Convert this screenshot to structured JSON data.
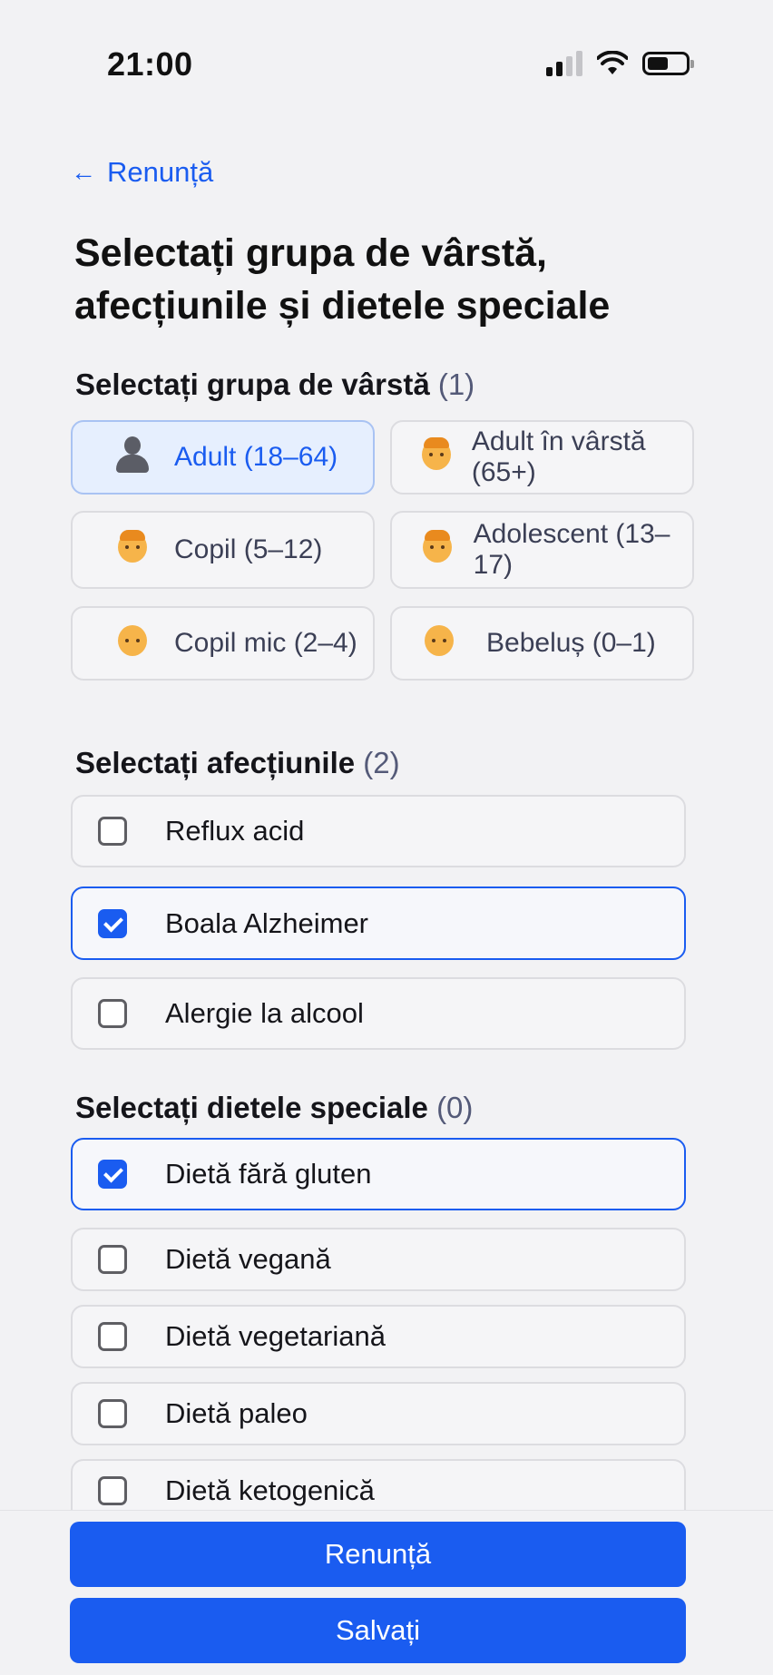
{
  "status_bar": {
    "time": "21:00",
    "signal_bars_filled": 2,
    "signal_bars_total": 4,
    "battery_level": 0.55,
    "icons": [
      "signal-icon",
      "wifi-icon",
      "battery-icon"
    ]
  },
  "header": {
    "back_arrow": "←",
    "back_label": "Renunță",
    "title": "Selectați grupa de vârstă, afecțiunile și dietele speciale"
  },
  "age_section": {
    "title": "Selectați grupa de vârstă",
    "count": "(1)",
    "options": [
      {
        "label": "Adult (18–64)",
        "icon": "person-silhouette-icon",
        "selected": true
      },
      {
        "label": "Adult în vârstă (65+)",
        "icon": "older-adult-emoji-icon",
        "selected": false
      },
      {
        "label": "Copil (5–12)",
        "icon": "child-emoji-icon",
        "selected": false
      },
      {
        "label": "Adolescent (13–17)",
        "icon": "teen-emoji-icon",
        "selected": false
      },
      {
        "label": "Copil mic (2–4)",
        "icon": "toddler-emoji-icon",
        "selected": false
      },
      {
        "label": "Bebeluș (0–1)",
        "icon": "baby-emoji-icon",
        "selected": false
      }
    ]
  },
  "conditions_section": {
    "title": "Selectați afecțiunile",
    "count": "(2)",
    "items": [
      {
        "label": "Reflux acid",
        "checked": false
      },
      {
        "label": "Boala Alzheimer",
        "checked": true
      },
      {
        "label": "Alergie la alcool",
        "checked": false
      }
    ]
  },
  "diets_section": {
    "title": "Selectați dietele speciale",
    "count": "(0)",
    "items": [
      {
        "label": "Dietă fără gluten",
        "checked": true
      },
      {
        "label": "Dietă vegană",
        "checked": false
      },
      {
        "label": "Dietă vegetariană",
        "checked": false
      },
      {
        "label": "Dietă paleo",
        "checked": false
      },
      {
        "label": "Dietă ketogenică",
        "checked": false
      }
    ]
  },
  "footer": {
    "cancel_label": "Renunță",
    "save_label": "Salvați"
  },
  "colors": {
    "accent": "#1a5cf0",
    "background": "#f2f2f4",
    "selected_card_bg": "#e6effe"
  }
}
